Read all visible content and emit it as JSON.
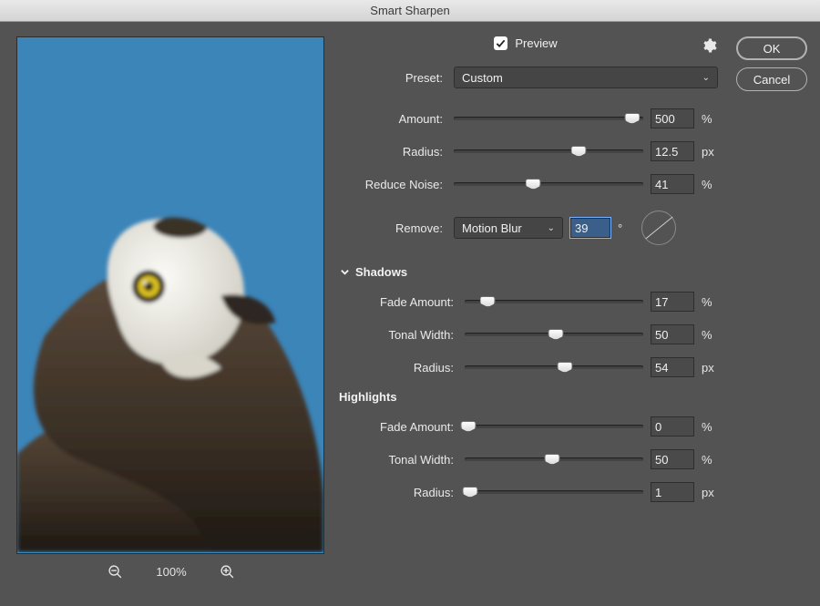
{
  "dialog": {
    "title": "Smart Sharpen"
  },
  "preview": {
    "checked": true,
    "label": "Preview"
  },
  "zoom": {
    "level": "100%"
  },
  "preset": {
    "label": "Preset:",
    "value": "Custom"
  },
  "sliders": {
    "amount": {
      "label": "Amount:",
      "value": "500",
      "unit": "%",
      "pos": 94
    },
    "radius": {
      "label": "Radius:",
      "value": "12.5",
      "unit": "px",
      "pos": 66
    },
    "reduce_noise": {
      "label": "Reduce Noise:",
      "value": "41",
      "unit": "%",
      "pos": 42
    }
  },
  "remove": {
    "label": "Remove:",
    "value": "Motion Blur",
    "angle": "39",
    "angleUnit": "°"
  },
  "shadows": {
    "heading": "Shadows",
    "fade_amount": {
      "label": "Fade Amount:",
      "value": "17",
      "unit": "%",
      "pos": 13
    },
    "tonal_width": {
      "label": "Tonal Width:",
      "value": "50",
      "unit": "%",
      "pos": 51
    },
    "radius": {
      "label": "Radius:",
      "value": "54",
      "unit": "px",
      "pos": 56
    }
  },
  "highlights": {
    "heading": "Highlights",
    "fade_amount": {
      "label": "Fade Amount:",
      "value": "0",
      "unit": "%",
      "pos": 2
    },
    "tonal_width": {
      "label": "Tonal Width:",
      "value": "50",
      "unit": "%",
      "pos": 49
    },
    "radius": {
      "label": "Radius:",
      "value": "1",
      "unit": "px",
      "pos": 3
    }
  },
  "buttons": {
    "ok": "OK",
    "cancel": "Cancel"
  }
}
